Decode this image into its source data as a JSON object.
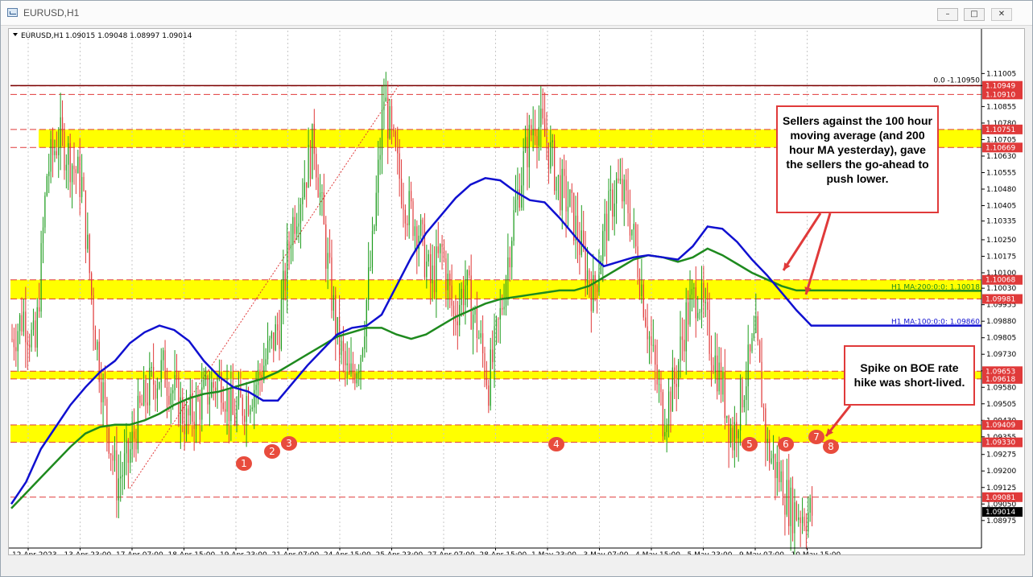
{
  "window": {
    "title": "EURUSD,H1",
    "buttons": {
      "minimize": "–",
      "maximize": "□",
      "close": "✕"
    }
  },
  "chart_data": {
    "type": "candlestick",
    "symbol": "EURUSD,H1",
    "ohlc_header": "1.09015 1.09048 1.08997 1.09014",
    "timeframe": "H1",
    "ylim": [
      1.0885,
      1.112
    ],
    "price_ticks": [
      "1.11005",
      "1.10950",
      "1.10855",
      "1.10780",
      "1.10705",
      "1.10630",
      "1.10555",
      "1.10480",
      "1.10405",
      "1.10335",
      "1.10250",
      "1.10175",
      "1.10100",
      "1.10030",
      "1.09955",
      "1.09880",
      "1.09805",
      "1.09730",
      "1.09655",
      "1.09580",
      "1.09505",
      "1.09430",
      "1.09355",
      "1.09275",
      "1.09200",
      "1.09125",
      "1.09050",
      "1.08975"
    ],
    "x_labels": [
      "12 Apr 2023",
      "13 Apr 23:00",
      "17 Apr 07:00",
      "18 Apr 15:00",
      "19 Apr 23:00",
      "21 Apr 07:00",
      "24 Apr 15:00",
      "25 Apr 23:00",
      "27 Apr 07:00",
      "28 Apr 15:00",
      "1 May 23:00",
      "3 May 07:00",
      "4 May 15:00",
      "5 May 23:00",
      "9 May 07:00",
      "10 May 15:00"
    ],
    "fib_label": "0.0 -1.10950",
    "price_tags": [
      {
        "value": "1.10949",
        "color": "#e03a3a"
      },
      {
        "value": "1.10910",
        "color": "#e03a3a"
      },
      {
        "value": "1.10751",
        "color": "#e03a3a"
      },
      {
        "value": "1.10669",
        "color": "#e03a3a"
      },
      {
        "value": "1.10068",
        "color": "#e03a3a"
      },
      {
        "value": "1.09981",
        "color": "#e03a3a"
      },
      {
        "value": "1.09653",
        "color": "#e03a3a"
      },
      {
        "value": "1.09618",
        "color": "#e03a3a"
      },
      {
        "value": "1.09409",
        "color": "#e03a3a"
      },
      {
        "value": "1.09330",
        "color": "#e03a3a"
      },
      {
        "value": "1.09081",
        "color": "#e03a3a"
      },
      {
        "value": "1.09014",
        "color": "#000000"
      }
    ],
    "zones": [
      {
        "from": 1.10669,
        "to": 1.10751
      },
      {
        "from": 1.09981,
        "to": 1.10068
      },
      {
        "from": 1.09618,
        "to": 1.09653
      },
      {
        "from": 1.0933,
        "to": 1.09409
      }
    ],
    "ma_labels": {
      "ma200": "H1 MA:200:0:0: 1.10018",
      "ma100": "H1 MA:100:0:0: 1.09860"
    },
    "ma200_values": [
      1.0903,
      1.091,
      1.0917,
      1.0924,
      1.0931,
      1.0937,
      1.094,
      1.0941,
      1.0941,
      1.0943,
      1.0946,
      1.095,
      1.0953,
      1.0955,
      1.0956,
      1.0958,
      1.096,
      1.0962,
      1.0965,
      1.0969,
      1.0973,
      1.0977,
      1.0981,
      1.0983,
      1.0985,
      1.0985,
      1.0982,
      1.098,
      1.0982,
      1.0986,
      1.099,
      1.0993,
      1.0996,
      1.0998,
      1.0999,
      1.1,
      1.1001,
      1.1002,
      1.1002,
      1.1004,
      1.1008,
      1.1012,
      1.1016,
      1.1018,
      1.1017,
      1.1015,
      1.1017,
      1.1021,
      1.1018,
      1.1014,
      1.101,
      1.1007,
      1.1004,
      1.1002,
      1.1002,
      1.1002
    ],
    "ma100_values": [
      1.0905,
      1.0915,
      1.093,
      1.094,
      1.095,
      1.0958,
      1.0965,
      1.097,
      1.0978,
      1.0983,
      1.0986,
      1.0984,
      1.0979,
      1.097,
      1.0963,
      1.0958,
      1.0956,
      1.0952,
      1.0952,
      1.096,
      1.0968,
      1.0975,
      1.0982,
      1.0985,
      1.0986,
      1.0991,
      1.1004,
      1.1017,
      1.1028,
      1.1036,
      1.1044,
      1.105,
      1.1053,
      1.1052,
      1.1047,
      1.1043,
      1.1042,
      1.1035,
      1.1027,
      1.1019,
      1.1013,
      1.1015,
      1.1017,
      1.1018,
      1.1017,
      1.1016,
      1.1022,
      1.1031,
      1.103,
      1.1024,
      1.1016,
      1.1009,
      1.1001,
      1.0993,
      1.0986,
      1.0986
    ],
    "candle_closes": [
      1.098,
      1.0991,
      1.0975,
      1.1055,
      1.1072,
      1.1062,
      1.105,
      1.099,
      1.0948,
      1.0915,
      1.0925,
      1.0947,
      1.096,
      1.0966,
      1.0955,
      1.0942,
      1.095,
      1.0957,
      1.0962,
      1.0944,
      1.0952,
      1.096,
      1.0973,
      1.0986,
      1.103,
      1.105,
      1.107,
      1.102,
      1.098,
      1.096,
      1.0975,
      1.102,
      1.109,
      1.106,
      1.104,
      1.103,
      1.1005,
      1.102,
      1.099,
      1.1005,
      1.0985,
      1.096,
      1.099,
      1.103,
      1.106,
      1.108,
      1.107,
      1.105,
      1.104,
      1.102,
      1.1,
      1.103,
      1.105,
      1.104,
      1.101,
      1.0975,
      1.0945,
      1.096,
      1.099,
      1.1002,
      1.098,
      1.096,
      1.0935,
      1.096,
      1.098,
      1.093,
      1.0918,
      1.0903,
      1.0901
    ],
    "annotations": {
      "sellers": "Sellers against the 100 hour moving average (and 200 hour MA yesterday), gave the sellers the go-ahead to push lower.",
      "spike": "Spike on BOE rate hike was short-lived."
    },
    "markers": [
      "1",
      "2",
      "3",
      "4",
      "5",
      "6",
      "7",
      "8"
    ],
    "colors": {
      "zone": "#ffff00",
      "ma200": "#1e8a1e",
      "ma100": "#1010d0",
      "bull": "#1e9c1e",
      "bear": "#e03a3a",
      "tag_red": "#e03a3a",
      "annotation_border": "#e03a3a"
    }
  }
}
